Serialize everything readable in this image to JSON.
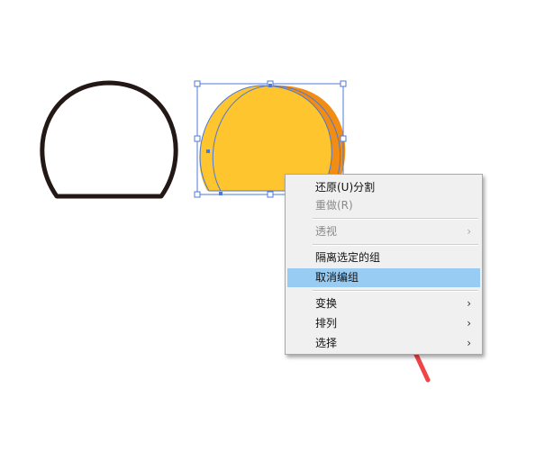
{
  "context_menu": {
    "items": [
      {
        "label": "还原(U)分割",
        "enabled": true,
        "submenu": false,
        "highlighted": false
      },
      {
        "label": "重做(R)",
        "enabled": false,
        "submenu": false,
        "highlighted": false
      },
      {
        "label": "透视",
        "enabled": false,
        "submenu": true,
        "highlighted": false
      },
      {
        "label": "隔离选定的组",
        "enabled": true,
        "submenu": false,
        "highlighted": false
      },
      {
        "label": "取消编组",
        "enabled": true,
        "submenu": false,
        "highlighted": true
      },
      {
        "label": "变换",
        "enabled": true,
        "submenu": true,
        "highlighted": false
      },
      {
        "label": "排列",
        "enabled": true,
        "submenu": true,
        "highlighted": false
      },
      {
        "label": "选择",
        "enabled": true,
        "submenu": true,
        "highlighted": false
      }
    ],
    "submenu_glyph": "›"
  },
  "colors": {
    "outline_shape": "#231815",
    "fill_main": "#fec52e",
    "fill_back": "#f18d13",
    "selection": "#4d7ad7",
    "menu_highlight": "#99ccf3",
    "annotation_arrow": "#ef4548"
  },
  "icons": [
    "submenu-arrow-icon",
    "annotation-arrow-icon"
  ]
}
